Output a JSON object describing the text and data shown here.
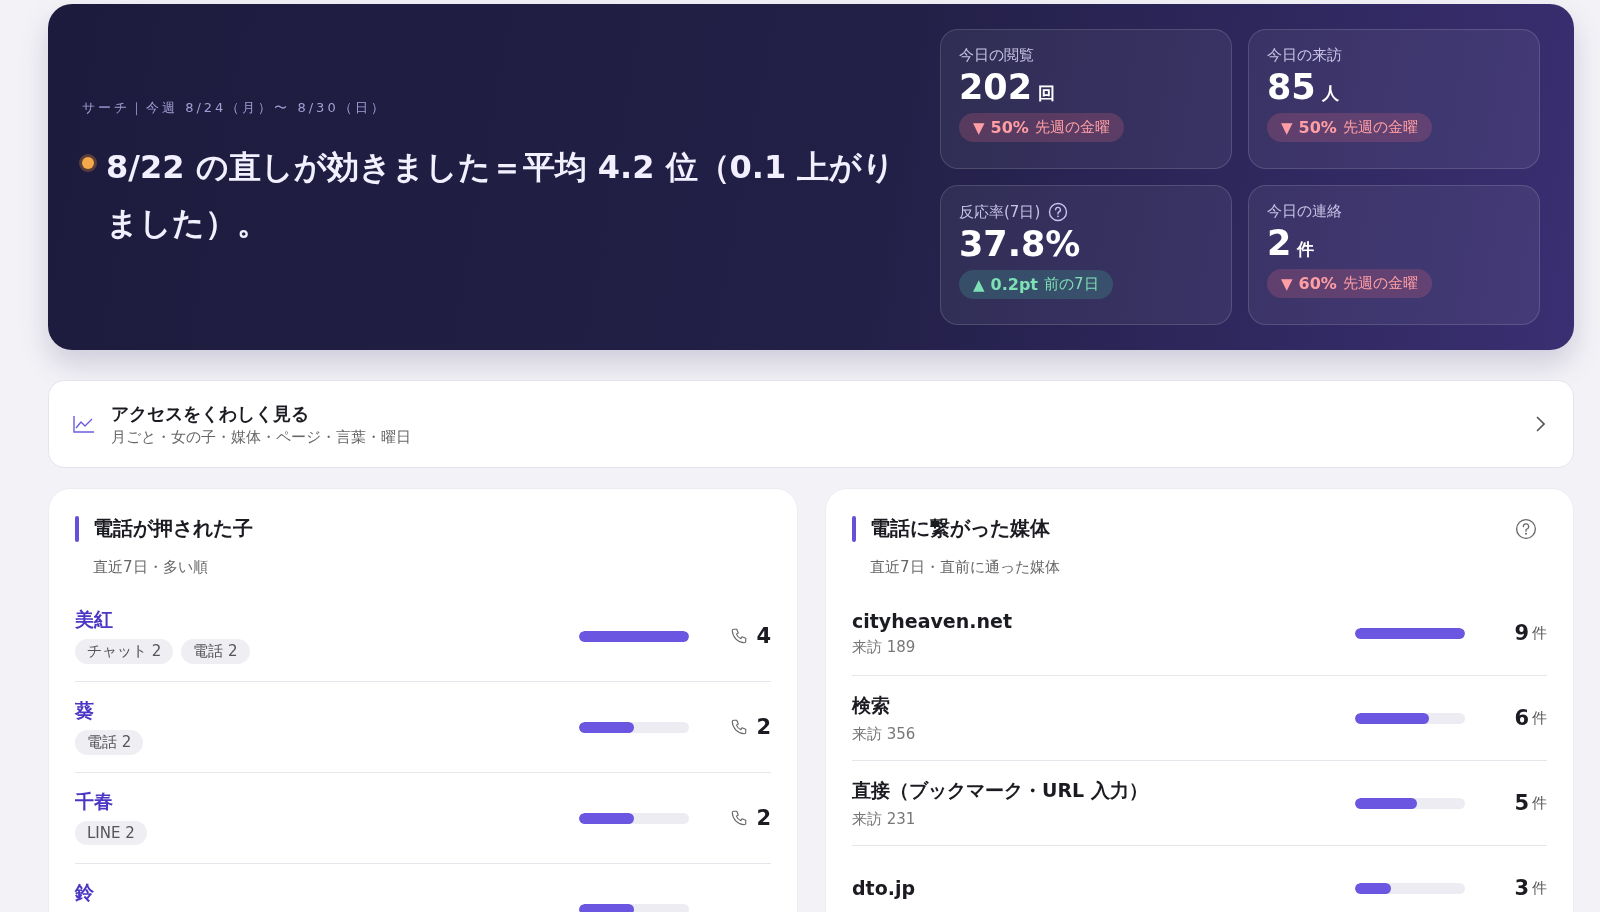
{
  "hero": {
    "eyebrow": "サーチ｜今週 8/24（月）〜 8/30（日）",
    "headline": "8/22 の直しが効きました＝平均 4.2 位（0.1 上がりました）。",
    "stats": [
      {
        "label": "今日の閲覧",
        "help": false,
        "value": "202",
        "unit": "回",
        "delta": {
          "kind": "down",
          "arrow": "▼",
          "amount": "50%",
          "compare": "先週の金曜"
        }
      },
      {
        "label": "今日の来訪",
        "help": false,
        "value": "85",
        "unit": "人",
        "delta": {
          "kind": "down",
          "arrow": "▼",
          "amount": "50%",
          "compare": "先週の金曜"
        }
      },
      {
        "label": "反応率(7日)",
        "help": true,
        "value": "37.8%",
        "delta": {
          "kind": "up",
          "arrow": "▲",
          "amount": "0.2pt",
          "compare": "前の7日"
        }
      },
      {
        "label": "今日の連絡",
        "help": false,
        "value": "2",
        "unit": "件",
        "delta": {
          "kind": "down",
          "arrow": "▼",
          "amount": "60%",
          "compare": "先週の金曜"
        }
      }
    ]
  },
  "access_link": {
    "title": "アクセスをくわしく見る",
    "subtitle": "月ごと・女の子・媒体・ページ・言葉・曜日"
  },
  "girls_panel": {
    "title": "電話が押された子",
    "subtitle": "直近7日・多い順",
    "help": false,
    "rows": [
      {
        "name": "美紅",
        "tags": [
          "チャット 2",
          "電話 2"
        ],
        "level": 1,
        "count": "4"
      },
      {
        "name": "葵",
        "tags": [
          "電話 2"
        ],
        "level": 0.5,
        "count": "2"
      },
      {
        "name": "千春",
        "tags": [
          "LINE 2"
        ],
        "level": 0.5,
        "count": "2"
      },
      {
        "name": "鈴",
        "tags": [],
        "level": 0.5
      }
    ]
  },
  "media_panel": {
    "title": "電話に繋がった媒体",
    "subtitle": "直近7日・直前に通った媒体",
    "help": true,
    "rows": [
      {
        "name": "cityheaven.net",
        "visits": "来訪 189",
        "level": 1,
        "count": "9",
        "unit": "件"
      },
      {
        "name": "検索",
        "visits": "来訪 356",
        "level": 0.67,
        "count": "6",
        "unit": "件"
      },
      {
        "name": "直接（ブックマーク・URL 入力）",
        "visits": "来訪 231",
        "level": 0.56,
        "count": "5",
        "unit": "件"
      },
      {
        "name": "dto.jp",
        "level": 0.33,
        "count": "3",
        "unit": "件"
      }
    ]
  }
}
